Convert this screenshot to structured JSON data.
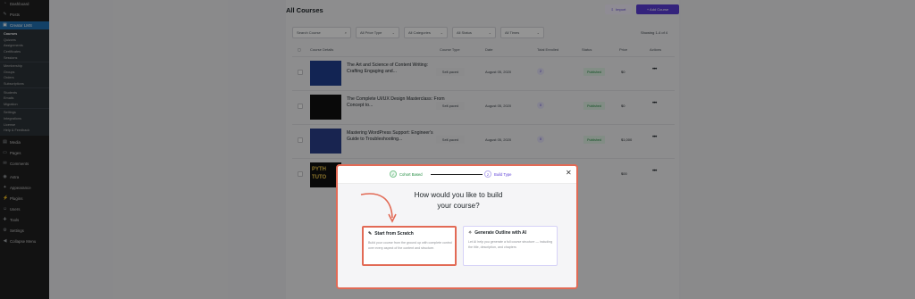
{
  "sidebar": {
    "top": [
      {
        "label": "Dashboard",
        "icon": "dashboard-icon",
        "glyph": "◔"
      },
      {
        "label": "Posts",
        "icon": "pin-icon",
        "glyph": "✎"
      },
      {
        "label": "Creator LMS",
        "icon": "lms-icon",
        "glyph": "▣"
      }
    ],
    "lms_sub": [
      "Courses",
      "Quizzes",
      "Assignments",
      "Certificates",
      "Sessions"
    ],
    "lms_sub2": [
      "Membership",
      "Groups",
      "Orders",
      "Subscriptions"
    ],
    "lms_sub3": [
      "Students",
      "Emails",
      "Migration"
    ],
    "lms_sub4": [
      "Settings",
      "Integrations",
      "License",
      "Help & Feedback"
    ],
    "bottom1": [
      {
        "label": "Media",
        "icon": "media-icon",
        "glyph": "▤"
      },
      {
        "label": "Pages",
        "icon": "pages-icon",
        "glyph": "▭"
      },
      {
        "label": "Comments",
        "icon": "comments-icon",
        "glyph": "✉"
      }
    ],
    "bottom2": [
      {
        "label": "Astra",
        "icon": "astra-icon",
        "glyph": "◉"
      },
      {
        "label": "Appearance",
        "icon": "appearance-icon",
        "glyph": "✦"
      },
      {
        "label": "Plugins",
        "icon": "plugins-icon",
        "glyph": "⚡"
      },
      {
        "label": "Users",
        "icon": "users-icon",
        "glyph": "☺"
      },
      {
        "label": "Tools",
        "icon": "tools-icon",
        "glyph": "✚"
      },
      {
        "label": "Settings",
        "icon": "settings-icon",
        "glyph": "⚙"
      },
      {
        "label": "Collapse Menu",
        "icon": "collapse-icon",
        "glyph": "◀"
      }
    ]
  },
  "page": {
    "title": "All Courses",
    "import_label": "Import",
    "add_label": "+ Add Course"
  },
  "filters": {
    "search_placeholder": "Search Course",
    "price_type": "All Price Type",
    "categories": "All Categories",
    "status": "All Status",
    "times": "All Times",
    "showing": "Showing 1-4 of 4"
  },
  "table": {
    "headers": [
      "Course Details",
      "Course Type",
      "Date",
      "Total Enrolled",
      "Status",
      "Price",
      "Actions"
    ],
    "rows": [
      {
        "title": "The Art and Science of Content Writing: Crafting Engaging and...",
        "type": "Self-paced",
        "date": "August 05, 2020",
        "enrolled": "2",
        "status": "Published",
        "price": "$0",
        "thumb_color": "#1f3f8f"
      },
      {
        "title": "The Complete UI/UX Design Masterclass: From Concept to...",
        "type": "Self-paced",
        "date": "August 05, 2020",
        "enrolled": "0",
        "status": "Published",
        "price": "$0",
        "thumb_color": "#111111"
      },
      {
        "title": "Mastering WordPress Support: Engineer's Guide to Troubleshooting...",
        "type": "Self-paced",
        "date": "August 05, 2020",
        "enrolled": "0",
        "status": "Published",
        "price": "$1,000",
        "thumb_color": "#2a3f8a"
      },
      {
        "title": "",
        "type": "",
        "date": "",
        "enrolled": "",
        "status": "",
        "price": "$00",
        "thumb_color": "#101010",
        "thumb_text": "PYTH TUTO"
      }
    ]
  },
  "modal": {
    "step1_label": "Cohort Based",
    "step2_label": "Build Type",
    "step2_num": "2",
    "heading_line1": "How would you like to build",
    "heading_line2": "your course?",
    "card1_title": "Start from Scratch",
    "card1_desc": "Build your course from the ground up with complete control over every aspect of the content and structure.",
    "card2_title": "Generate Outline with AI",
    "card2_desc": "Let AI help you generate a full course structure — including the title, description, and chapters"
  },
  "colors": {
    "accent": "#5b3dd6",
    "highlight": "#e26a55",
    "sidebar_active": "#2271b1"
  }
}
